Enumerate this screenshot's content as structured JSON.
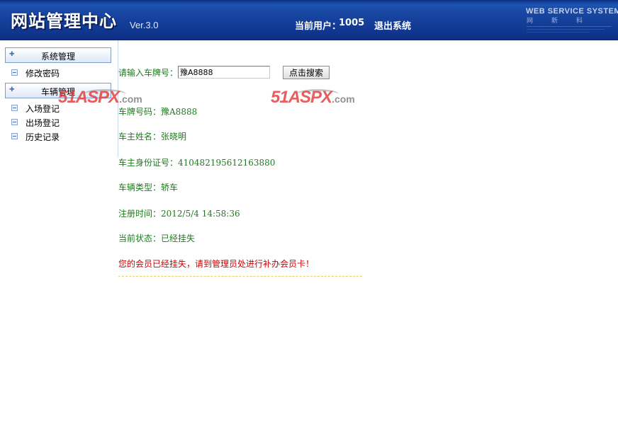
{
  "header": {
    "title": "网站管理中心",
    "version": "Ver.3.0",
    "current_user_label": "当前用户：",
    "current_user_id": "1005",
    "logout_label": "退出系统",
    "brand_text": "WEB SERVICE SYSTEM",
    "brand_sub": "网新科"
  },
  "sidebar": {
    "groups": [
      {
        "label": "系统管理",
        "items": [
          {
            "label": "修改密码"
          }
        ]
      },
      {
        "label": "车辆管理",
        "items": [
          {
            "label": "入场登记"
          },
          {
            "label": "出场登记"
          },
          {
            "label": "历史记录"
          }
        ]
      }
    ]
  },
  "watermark": {
    "main": "51ASPX",
    "suffix": ".com"
  },
  "search": {
    "label": "请输入车牌号：",
    "value": "豫A8888",
    "button_label": "点击搜索"
  },
  "result": {
    "plate": {
      "label": "车牌号码：",
      "value": "豫A8888"
    },
    "owner": {
      "label": "车主姓名：",
      "value": "张晓明"
    },
    "id_number": {
      "label": "车主身份证号：",
      "value": "410482195612163880"
    },
    "vehicle_type": {
      "label": "车辆类型：",
      "value": "轿车"
    },
    "register_time": {
      "label": "注册时间：",
      "value": "2012/5/4 14:58:36"
    },
    "status": {
      "label": "当前状态：",
      "value": "已经挂失"
    },
    "alert": "您的会员已经挂失，请到管理员处进行补办会员卡！"
  },
  "colors": {
    "header_bg": "#1a4aa6",
    "label_green": "#1f7a1f",
    "alert_red": "#cc0000"
  }
}
